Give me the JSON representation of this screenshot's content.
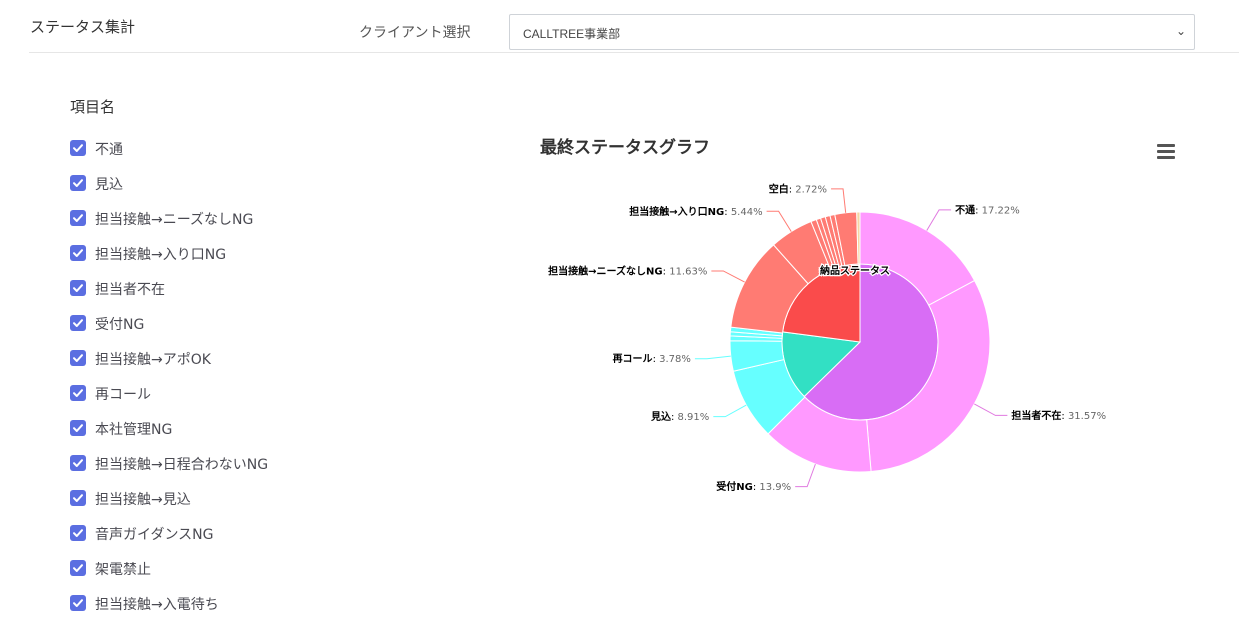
{
  "header": {
    "title": "ステータス集計",
    "client_label": "クライアント選択",
    "client_value": "CALLTREE事業部"
  },
  "sidebar": {
    "title": "項目名",
    "items": [
      {
        "label": "不通",
        "checked": true
      },
      {
        "label": "見込",
        "checked": true
      },
      {
        "label": "担当接触→ニーズなしNG",
        "checked": true
      },
      {
        "label": "担当接触→入り口NG",
        "checked": true
      },
      {
        "label": "担当者不在",
        "checked": true
      },
      {
        "label": "受付NG",
        "checked": true
      },
      {
        "label": "担当接触→アポOK",
        "checked": true
      },
      {
        "label": "再コール",
        "checked": true
      },
      {
        "label": "本社管理NG",
        "checked": true
      },
      {
        "label": "担当接触→日程合わないNG",
        "checked": true
      },
      {
        "label": "担当接触→見込",
        "checked": true
      },
      {
        "label": "音声ガイダンスNG",
        "checked": true
      },
      {
        "label": "架電禁止",
        "checked": true
      },
      {
        "label": "担当接触→入電待ち",
        "checked": true
      }
    ]
  },
  "chart_data": {
    "type": "pie",
    "title": "最終ステータスグラフ",
    "inner_label": "納品ステータス",
    "inner": [
      {
        "name": "pink-group",
        "value": 62.69,
        "color": "#d86df5"
      },
      {
        "name": "cyan-group",
        "value": 14.37,
        "color": "#32e0c4"
      },
      {
        "name": "red-group",
        "value": 22.94,
        "color": "#fa4b4b"
      }
    ],
    "outer": [
      {
        "name": "不通",
        "value": 17.22,
        "color": "#ff99ff",
        "labeled": true
      },
      {
        "name": "担当者不在",
        "value": 31.57,
        "color": "#ff99ff",
        "labeled": true
      },
      {
        "name": "受付NG",
        "value": 13.9,
        "color": "#ff99ff",
        "labeled": true
      },
      {
        "name": "見込",
        "value": 8.91,
        "color": "#66ffff",
        "labeled": true
      },
      {
        "name": "再コール",
        "value": 3.78,
        "color": "#66ffff",
        "labeled": true
      },
      {
        "name": "",
        "value": 0.6,
        "color": "#66ffff",
        "labeled": false
      },
      {
        "name": "",
        "value": 0.5,
        "color": "#66ffff",
        "labeled": false
      },
      {
        "name": "",
        "value": 0.58,
        "color": "#66ffff",
        "labeled": false
      },
      {
        "name": "担当接触→ニーズなしNG",
        "value": 11.63,
        "color": "#ff7b73",
        "labeled": true
      },
      {
        "name": "担当接触→入り口NG",
        "value": 5.44,
        "color": "#ff7b73",
        "labeled": true
      },
      {
        "name": "",
        "value": 0.7,
        "color": "#ff7b73",
        "labeled": false
      },
      {
        "name": "",
        "value": 0.55,
        "color": "#ff7b73",
        "labeled": false
      },
      {
        "name": "",
        "value": 0.6,
        "color": "#ff7b73",
        "labeled": false
      },
      {
        "name": "",
        "value": 0.6,
        "color": "#ff7b73",
        "labeled": false
      },
      {
        "name": "",
        "value": 0.6,
        "color": "#ff7b73",
        "labeled": false
      },
      {
        "name": "空白",
        "value": 2.72,
        "color": "#ff7b73",
        "labeled": true
      },
      {
        "name": "",
        "value": 0.4,
        "color": "#f5d5a3",
        "labeled": false
      }
    ],
    "label_unit": "%"
  }
}
